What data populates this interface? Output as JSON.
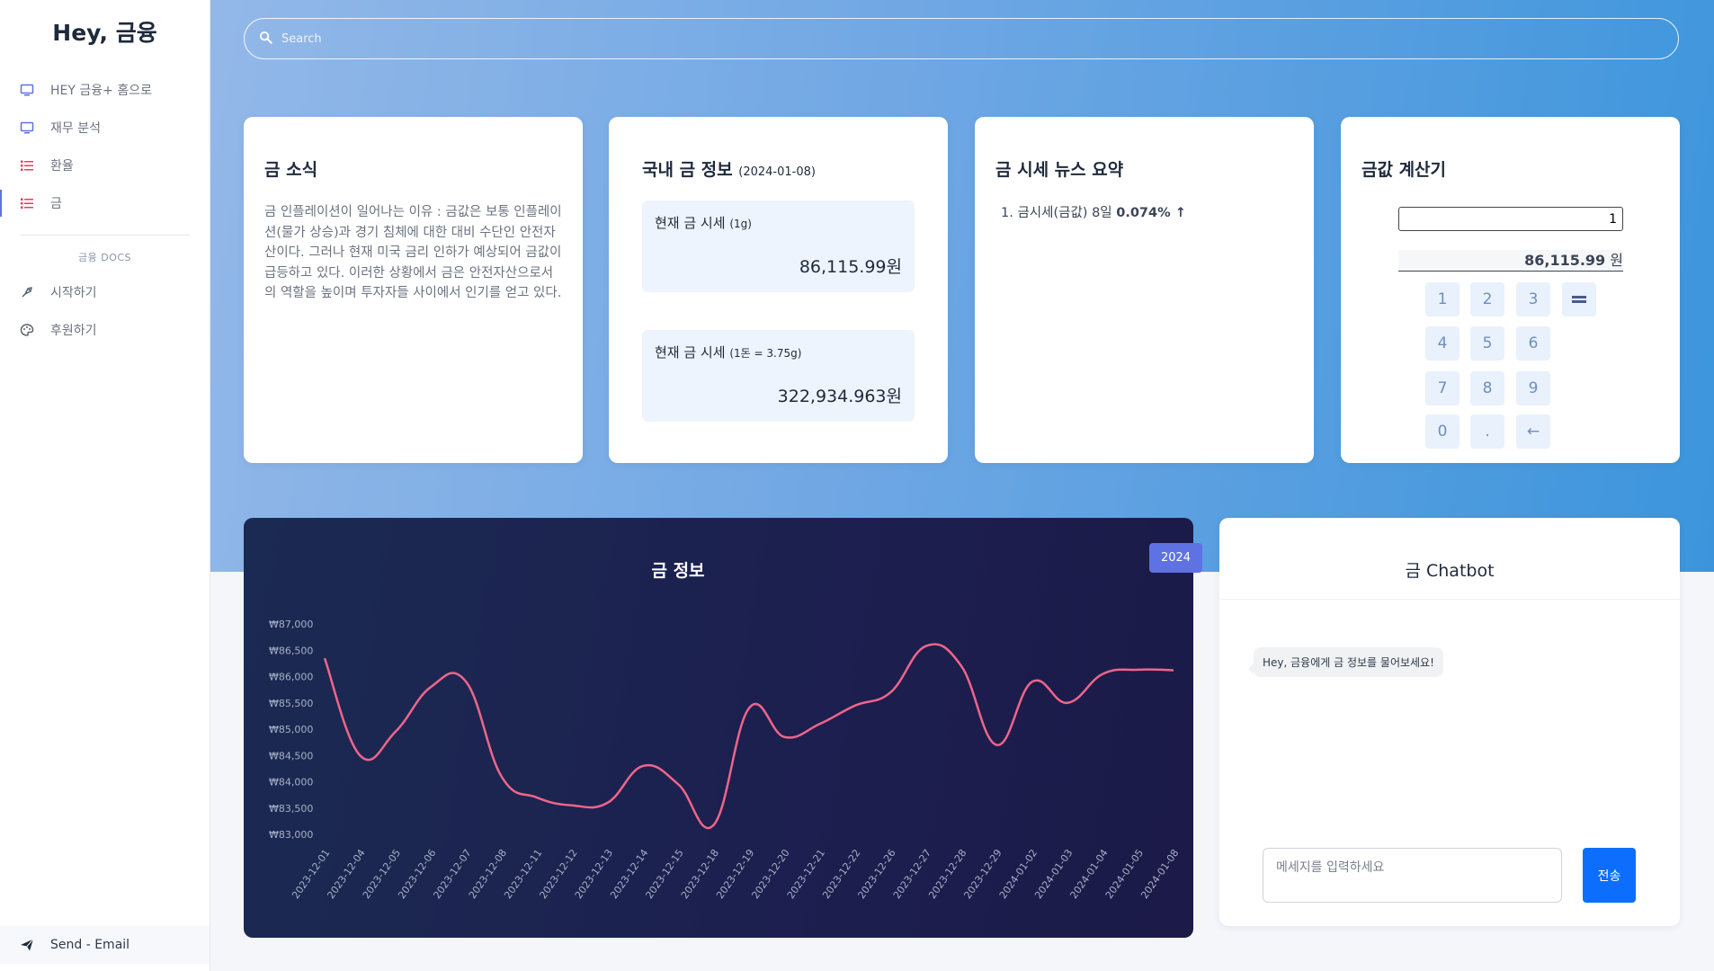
{
  "brand": "Hey, 금융",
  "sidebar": {
    "items": [
      {
        "label": "HEY 금융+ 홈으로",
        "icon": "monitor-icon"
      },
      {
        "label": "재무 분석",
        "icon": "monitor-icon"
      },
      {
        "label": "환율",
        "icon": "list-icon"
      },
      {
        "label": "금",
        "icon": "list-icon"
      }
    ],
    "docs_heading": "금융 DOCS",
    "docs_items": [
      {
        "label": "시작하기",
        "icon": "rocket-icon"
      },
      {
        "label": "후원하기",
        "icon": "palette-icon"
      }
    ],
    "footer_label": "Send - Email"
  },
  "search": {
    "placeholder": "Search"
  },
  "news_card": {
    "title": "금 소식",
    "body": "금 인플레이션이 일어나는 이유 : 금값은 보통 인플레이션(물가 상승)과 경기 침체에 대한 대비 수단인 안전자산이다. 그러나 현재 미국 금리 인하가 예상되어 금값이 급등하고 있다. 이러한 상황에서 금은 안전자산으로서의 역할을 높이며 투자자들 사이에서 인기를 얻고 있다."
  },
  "domestic_card": {
    "title": "국내 금 정보",
    "date": "(2024-01-08)",
    "price1_label": "현재 금 시세",
    "price1_unit": "(1g)",
    "price1_value": "86,115.99원",
    "price2_label": "현재 금 시세",
    "price2_unit": "(1돈 = 3.75g)",
    "price2_value": "322,934.963원"
  },
  "summary_card": {
    "title": "금 시세 뉴스 요약",
    "item_prefix": "1. 금시세(금값) 8일 ",
    "item_value": "0.074% ↑"
  },
  "calculator": {
    "title": "금값 계산기",
    "input_value": "1",
    "result": "86,115.99",
    "result_unit": " 원",
    "keys": [
      "1",
      "2",
      "3",
      "4",
      "5",
      "6",
      "7",
      "8",
      "9",
      "0",
      ".",
      "←"
    ],
    "equals": "="
  },
  "chart_card": {
    "title": "금 정보",
    "year_badge": "2024"
  },
  "chart_data": {
    "type": "line",
    "title": "금 정보",
    "categories": [
      "2023-12-01",
      "2023-12-04",
      "2023-12-05",
      "2023-12-06",
      "2023-12-07",
      "2023-12-08",
      "2023-12-11",
      "2023-12-12",
      "2023-12-13",
      "2023-12-14",
      "2023-12-15",
      "2023-12-18",
      "2023-12-19",
      "2023-12-20",
      "2023-12-21",
      "2023-12-22",
      "2023-12-26",
      "2023-12-27",
      "2023-12-28",
      "2023-12-29",
      "2024-01-02",
      "2024-01-03",
      "2024-01-04",
      "2024-01-05",
      "2024-01-08"
    ],
    "values": [
      86350,
      84500,
      84950,
      85800,
      85900,
      84100,
      83700,
      83550,
      83600,
      84300,
      83950,
      83180,
      85400,
      84850,
      85100,
      85450,
      85700,
      86580,
      86200,
      84700,
      85900,
      85500,
      86050,
      86130,
      86120
    ],
    "y_ticks": [
      "₩87,000",
      "₩86,500",
      "₩86,000",
      "₩85,500",
      "₩85,000",
      "₩84,500",
      "₩84,000",
      "₩83,500",
      "₩83,000"
    ],
    "ylim": [
      83000,
      87000
    ],
    "grid": false,
    "line_color": "#f0658a"
  },
  "chatbot": {
    "title": "금 Chatbot",
    "message": "Hey, 금융에게 금 정보를 물어보세요!",
    "input_placeholder": "메세지를 입력하세요",
    "send_label": "전송"
  }
}
